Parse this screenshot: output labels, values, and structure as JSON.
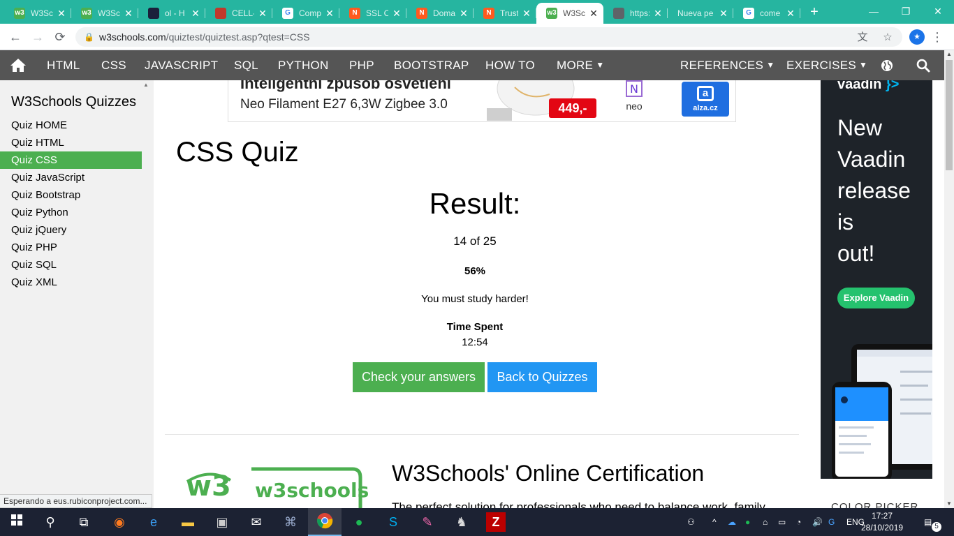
{
  "browser": {
    "tabs": [
      {
        "title": "W3Sc",
        "favicon_color": "#4caf50",
        "favicon_text": "w3",
        "active": false
      },
      {
        "title": "W3Sc",
        "favicon_color": "#4caf50",
        "favicon_text": "w3",
        "active": false
      },
      {
        "title": "ol - H",
        "favicon_color": "#1b1f3b",
        "favicon_text": "",
        "active": false
      },
      {
        "title": "CELL-",
        "favicon_color": "#c0392b",
        "favicon_text": "",
        "active": false
      },
      {
        "title": "Comp",
        "favicon_color": "#ffffff",
        "favicon_text": "G",
        "active": false
      },
      {
        "title": "SSL C",
        "favicon_color": "#ff5a1f",
        "favicon_text": "N",
        "active": false
      },
      {
        "title": "Doma",
        "favicon_color": "#ff5a1f",
        "favicon_text": "N",
        "active": false
      },
      {
        "title": "Truste",
        "favicon_color": "#ff5a1f",
        "favicon_text": "N",
        "active": false
      },
      {
        "title": "W3Sc",
        "favicon_color": "#4caf50",
        "favicon_text": "w3",
        "active": true
      },
      {
        "title": "https:",
        "favicon_color": "#5f6368",
        "favicon_text": "",
        "active": false
      },
      {
        "title": "Nueva pe",
        "favicon_color": "",
        "favicon_text": "",
        "active": false
      },
      {
        "title": "come",
        "favicon_color": "#ffffff",
        "favicon_text": "G",
        "active": false
      }
    ],
    "new_tab": "+",
    "close_glyph": "✕",
    "window": {
      "minimize": "—",
      "maximize": "❐",
      "close": "✕"
    },
    "url_host": "w3schools.com",
    "url_path": "/quiztest/quiztest.asp?qtest=CSS",
    "profile_initial": "★",
    "status_text": "Esperando a eus.rubiconproject.com..."
  },
  "nav": {
    "items": [
      "HTML",
      "CSS",
      "JAVASCRIPT",
      "SQL",
      "PYTHON",
      "PHP",
      "BOOTSTRAP",
      "HOW TO",
      "MORE",
      "REFERENCES",
      "EXERCISES"
    ],
    "accent": "#555555"
  },
  "sidebar": {
    "title": "W3Schools Quizzes",
    "items": [
      "Quiz HOME",
      "Quiz HTML",
      "Quiz CSS",
      "Quiz JavaScript",
      "Quiz Bootstrap",
      "Quiz Python",
      "Quiz jQuery",
      "Quiz PHP",
      "Quiz SQL",
      "Quiz XML"
    ],
    "active_index": 2,
    "active_color": "#4caf50"
  },
  "ad_top": {
    "line1": "Inteligentní způsob osvětlení",
    "line2": "Neo Filament E27 6,3W Zigbee 3.0",
    "price": "449,-",
    "brand": "neo",
    "shop": "alza.cz"
  },
  "quiz": {
    "title": "CSS Quiz",
    "result_heading": "Result:",
    "score": "14 of 25",
    "percent": "56%",
    "message": "You must study harder!",
    "time_label": "Time Spent",
    "time_value": "12:54",
    "check_button": "Check your answers",
    "back_button": "Back to Quizzes"
  },
  "certification": {
    "title": "W3Schools' Online Certification",
    "subtitle": "The perfect solution for professionals who need to balance work, family...",
    "logo_text": "w3schools"
  },
  "right_peek_text": "COLOR PICKER",
  "vaadin_ad": {
    "logo": "vaadin",
    "logo_suffix": "}>",
    "headline_lines": [
      "New",
      "Vaadin",
      "release",
      "is",
      "out!"
    ],
    "cta": "Explore Vaadin",
    "bg_color": "#1e2329",
    "cta_color": "#25c26e"
  },
  "taskbar": {
    "time": "17:27",
    "date": "28/10/2019",
    "language": "ENG",
    "notification_count": "5"
  }
}
